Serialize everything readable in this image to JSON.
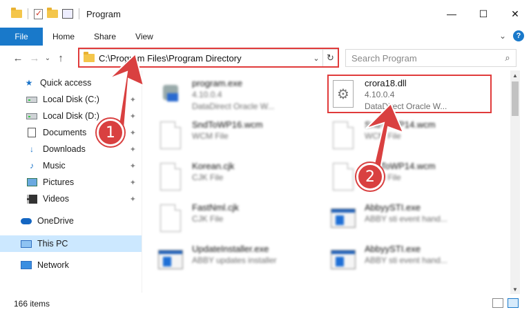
{
  "window": {
    "title": "Program",
    "minimize_glyph": "—",
    "maximize_glyph": "☐",
    "close_glyph": "✕"
  },
  "ribbon": {
    "tabs": [
      "File",
      "Home",
      "Share",
      "View"
    ],
    "expand_glyph": "⌄",
    "help_glyph": "?"
  },
  "address": {
    "path": "C:\\Program Files\\Program Directory",
    "dropdown_glyph": "⌄",
    "refresh_glyph": "↻",
    "back_glyph": "←",
    "forward_glyph": "→",
    "history_glyph": "⌄",
    "up_glyph": "↑"
  },
  "search": {
    "placeholder": "Search Program",
    "icon": "search-icon",
    "glyph": "⌕"
  },
  "sidebar": {
    "items": [
      {
        "label": "Quick access",
        "icon": "star-icon",
        "pinned": false
      },
      {
        "label": "Local Disk (C:)",
        "icon": "drive-icon",
        "pinned": true
      },
      {
        "label": "Local Disk (D:)",
        "icon": "drive-icon",
        "pinned": true
      },
      {
        "label": "Documents",
        "icon": "documents-icon",
        "pinned": true
      },
      {
        "label": "Downloads",
        "icon": "downloads-icon",
        "pinned": true
      },
      {
        "label": "Music",
        "icon": "music-icon",
        "pinned": true
      },
      {
        "label": "Pictures",
        "icon": "pictures-icon",
        "pinned": true
      },
      {
        "label": "Videos",
        "icon": "videos-icon",
        "pinned": true
      },
      {
        "label": "OneDrive",
        "icon": "onedrive-icon",
        "pinned": false
      },
      {
        "label": "This PC",
        "icon": "this-pc-icon",
        "pinned": false,
        "selected": true
      },
      {
        "label": "Network",
        "icon": "network-icon",
        "pinned": false
      }
    ],
    "pin_glyph": "📌",
    "star_glyph": "★",
    "download_glyph": "↓",
    "music_glyph": "♪"
  },
  "files": [
    {
      "name": "program.exe",
      "line2": "4.10.0.4",
      "line3": "DataDirect Oracle W...",
      "icon": "exe-icon",
      "blurred": true
    },
    {
      "name": "crora18.dll",
      "line2": "4.10.0.4",
      "line3": "DataDirect Oracle W...",
      "icon": "dll-gear-icon",
      "blurred": false,
      "highlighted": true
    },
    {
      "name": "SndToWP16.wcm",
      "line2": "WCM File",
      "line3": "",
      "icon": "file-icon",
      "blurred": true
    },
    {
      "name": "SndToWP14.wcm",
      "line2": "WCM File",
      "line3": "",
      "icon": "file-icon",
      "blurred": true
    },
    {
      "name": "Korean.cjk",
      "line2": "CJK File",
      "line3": "",
      "icon": "file-icon",
      "blurred": true
    },
    {
      "name": "SndToWP14.wcm",
      "line2": "WCM File",
      "line3": "",
      "icon": "file-icon",
      "blurred": true
    },
    {
      "name": "FastNml.cjk",
      "line2": "CJK File",
      "line3": "",
      "icon": "file-icon",
      "blurred": true
    },
    {
      "name": "AbbyySTI.exe",
      "line2": "ABBY sti event hand...",
      "line3": "",
      "icon": "app-icon",
      "blurred": true
    },
    {
      "name": "UpdateInstaller.exe",
      "line2": "ABBY updates installer",
      "line3": "",
      "icon": "app-icon",
      "blurred": true
    },
    {
      "name": "AbbyySTI.exe",
      "line2": "ABBY sti event hand...",
      "line3": "",
      "icon": "app-icon",
      "blurred": true
    }
  ],
  "status": {
    "item_count": "166 items"
  },
  "annotations": {
    "step1": "1",
    "step2": "2",
    "color": "#d94040"
  },
  "colors": {
    "accent": "#1979ca",
    "highlight_border": "#e03a3a",
    "selected_nav": "#cce8ff"
  }
}
